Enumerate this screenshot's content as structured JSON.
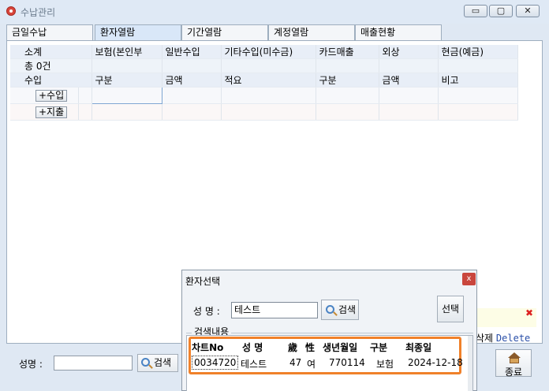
{
  "window": {
    "title": "수납관리",
    "minimize": "▭",
    "maximize": "▢",
    "close": "✕"
  },
  "tabs": [
    {
      "label": "금일수납",
      "active": false
    },
    {
      "label": "환자열람",
      "active": true
    },
    {
      "label": "기간열람",
      "active": false
    },
    {
      "label": "계정열람",
      "active": false
    },
    {
      "label": "매출현황",
      "active": false
    }
  ],
  "grid": {
    "header": [
      "소계",
      "보험(본인부",
      "일반수입",
      "기타수입(미수금)",
      "카드매출",
      "외상",
      "현금(예금)"
    ],
    "count_row": "총 0건",
    "sub_header": [
      "수입",
      "구분",
      "금액",
      "적요",
      "구분",
      "금액",
      "비고"
    ],
    "income_button": "+수입",
    "expense_button": "+지출"
  },
  "bottom": {
    "name_label": "성명 :",
    "search_button": "검색",
    "delete_hint_ko": "삭제",
    "delete_hint_key": "Delete",
    "close_button": "종료"
  },
  "dialog": {
    "title": "환자선택",
    "close": "x",
    "name_label": "성 명 :",
    "name_value": "테스트",
    "search_button": "검색",
    "select_button": "선택",
    "group_label": "검색내용",
    "columns": [
      "차트No",
      "성 명",
      "歲",
      "性",
      "생년월일",
      "구분",
      "최종일"
    ],
    "rows": [
      [
        "0034720",
        "테스트",
        "47",
        "여",
        "770114",
        "보험",
        "2024-12-18"
      ]
    ]
  },
  "colors": {
    "highlight": "#f0812a",
    "active_tab": "#d9e7f8",
    "window_bg": "#dfe8f3"
  }
}
